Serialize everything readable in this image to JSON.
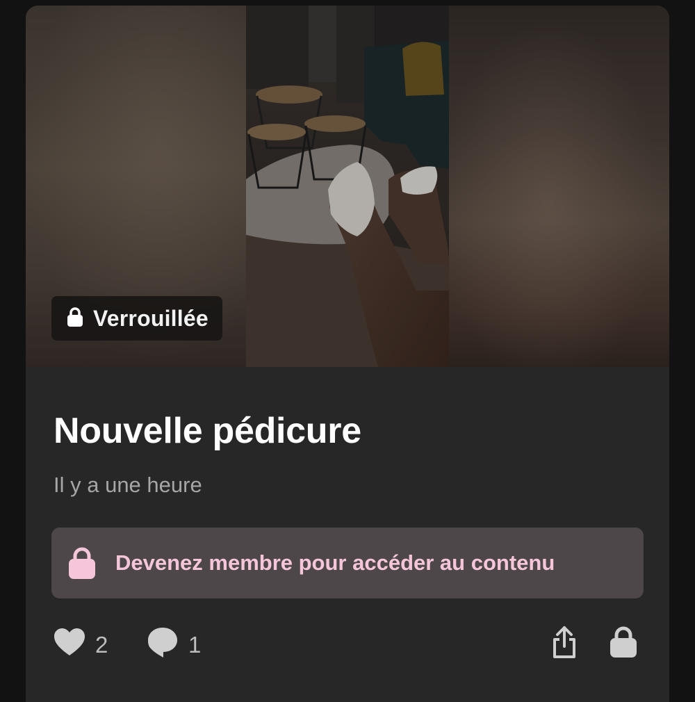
{
  "post": {
    "locked_badge": "Verrouillée",
    "title": "Nouvelle pédicure",
    "timestamp": "Il y a une heure",
    "join_cta": "Devenez membre pour accéder au contenu",
    "likes": "2",
    "comments": "1"
  },
  "icons": {
    "badge": "lock-icon",
    "cta": "lock-icon",
    "like": "heart-icon",
    "comment": "comment-bubble-icon",
    "share": "share-icon",
    "locked": "lock-icon"
  },
  "colors": {
    "card_background": "#272727",
    "page_background": "#121212",
    "cta_background": "#4d4749",
    "cta_text": "#f5c6d9",
    "title_text": "#ffffff",
    "muted_text": "#a6a6a6"
  }
}
